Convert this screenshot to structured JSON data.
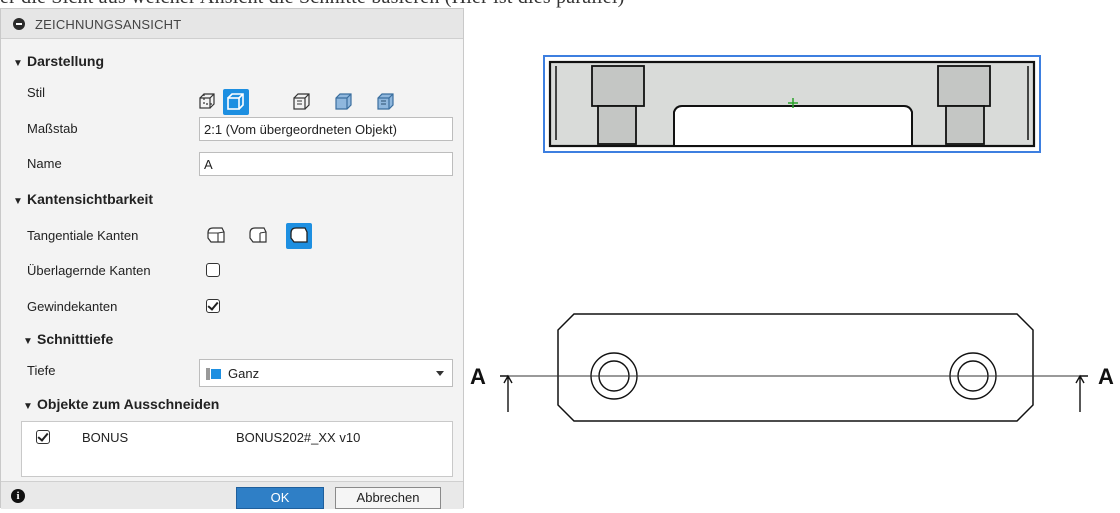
{
  "top_text": "er die Sicht aus welcher Ansicht die Schnitte basieren (Hier ist dies parallel)",
  "panel": {
    "title": "ZEICHNUNGSANSICHT",
    "sections": {
      "darstellung": "Darstellung",
      "kantensichtbarkeit": "Kantensichtbarkeit",
      "schnitttiefe": "Schnitttiefe",
      "objekte": "Objekte zum Ausschneiden"
    },
    "fields": {
      "stil_label": "Stil",
      "massstab_label": "Maßstab",
      "massstab_value": "2:1 (Vom übergeordneten Objekt)",
      "name_label": "Name",
      "name_value": "A",
      "tangential_label": "Tangentiale Kanten",
      "ueberlagernd_label": "Überlagernde Kanten",
      "gewinde_label": "Gewindekanten",
      "tiefe_label": "Tiefe",
      "tiefe_value": "Ganz"
    },
    "checkboxes": {
      "ueberlagernd": false,
      "gewinde": true,
      "bonus": true
    },
    "objects": [
      {
        "name": "BONUS",
        "document": "BONUS202#_XX v10"
      }
    ],
    "buttons": {
      "ok": "OK",
      "cancel": "Abbrechen"
    },
    "icons": [
      "collapse-icon",
      "info-icon",
      "style-visible-edges-icon",
      "style-shaded-icon",
      "style-hidden-edges-icon",
      "style-shaded-hidden-icon",
      "tangent-edges-icon",
      "select-depth-icon"
    ],
    "colors": {
      "accent": "#1d8fe1",
      "ok_button": "#2f7fc6",
      "selection_outline": "#3d7fe0"
    }
  },
  "drawing": {
    "section_label_left": "A",
    "section_label_right": "A"
  }
}
